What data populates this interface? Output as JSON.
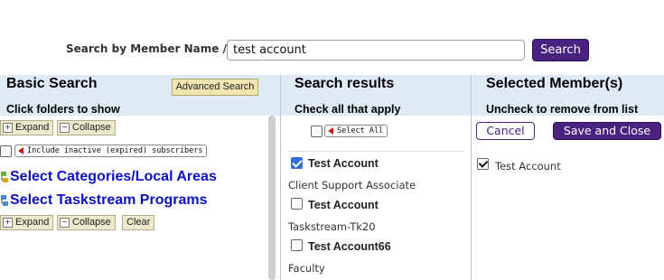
{
  "search": {
    "label": "Search by Member Name /Id:",
    "value": "test account",
    "button_label": "Search"
  },
  "basic": {
    "title": "Basic Search",
    "advanced_label": "Advanced Search",
    "subtitle": "Click folders to show",
    "expand_label": "Expand",
    "collapse_label": "Collapse",
    "clear_label": "Clear",
    "include_inactive_label": "Include inactive (expired) subscribers",
    "links": [
      "Select Categories/Local Areas",
      "Select Taskstream Programs"
    ]
  },
  "results": {
    "title": "Search results",
    "subtitle": "Check all that apply",
    "select_all_label": "Select All",
    "items": [
      {
        "name": "Test Account",
        "sub": "Client Support Associate",
        "checked": true
      },
      {
        "name": "Test Account",
        "sub": "Taskstream-Tk20",
        "checked": false
      },
      {
        "name": "Test Account66",
        "sub": "Faculty",
        "checked": false
      }
    ]
  },
  "selected": {
    "title": "Selected Member(s)",
    "subtitle": "Uncheck to remove from list",
    "cancel_label": "Cancel",
    "save_label": "Save and Close",
    "members": [
      {
        "name": "Test Account",
        "checked": true
      }
    ]
  },
  "colors": {
    "accent": "#4a2380",
    "header_bg": "#dfeaf6",
    "link": "#0a10c4"
  }
}
